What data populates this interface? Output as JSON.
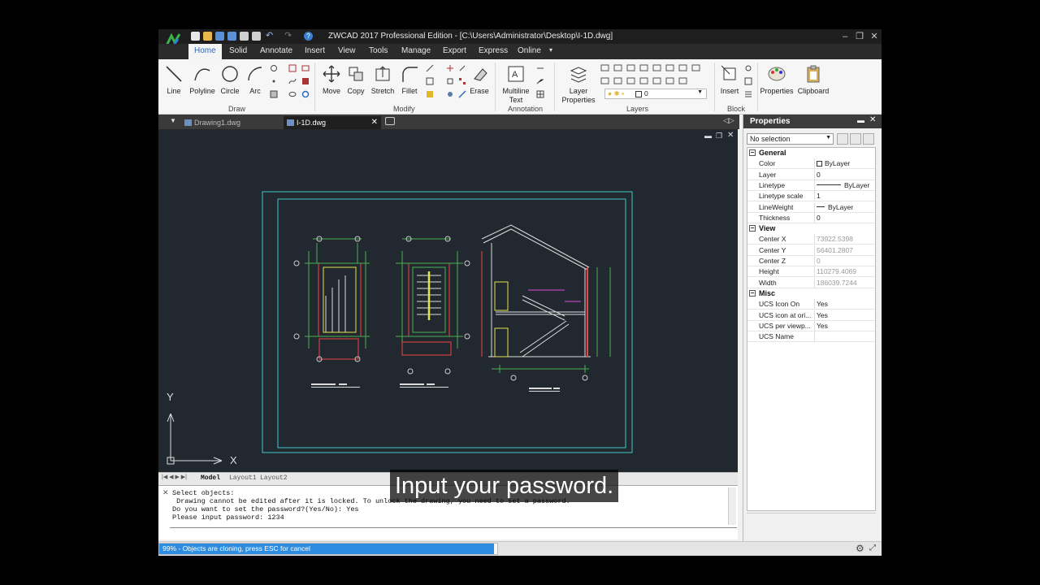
{
  "app": {
    "title": "ZWCAD 2017 Professional Edition - [C:\\Users\\Administrator\\Desktop\\I-1D.dwg]"
  },
  "ribbon_tabs": [
    "Home",
    "Solid",
    "Annotate",
    "Insert",
    "View",
    "Tools",
    "Manage",
    "Export",
    "Express",
    "Online"
  ],
  "ribbon": {
    "draw": {
      "label": "Draw",
      "tools": [
        "Line",
        "Polyline",
        "Circle",
        "Arc"
      ]
    },
    "modify": {
      "label": "Modify",
      "tools": [
        "Move",
        "Copy",
        "Stretch",
        "Fillet",
        "Erase"
      ]
    },
    "annotation": {
      "label": "Annotation",
      "tool": "Multiline",
      "tool2": "Text"
    },
    "layers": {
      "label": "Layers",
      "tool": "Layer",
      "tool2": "Properties",
      "current_layer": "0"
    },
    "block": {
      "label": "Block",
      "tool": "Insert"
    },
    "properties_tool": "Properties",
    "clipboard_tool": "Clipboard"
  },
  "doc_tabs": [
    {
      "label": "Drawing1.dwg",
      "active": false
    },
    {
      "label": "I-1D.dwg",
      "active": true
    }
  ],
  "canvas": {
    "ucs_x": "X",
    "ucs_y": "Y"
  },
  "layout_tabs": [
    "Model",
    "Layout1",
    "Layout2"
  ],
  "command": {
    "lines": [
      "Select objects:",
      " Drawing cannot be edited after it is locked. To unlock the drawing, you need to set a password.",
      "Do you want to set the password?(Yes/No): Yes",
      "Please input password: 1234"
    ]
  },
  "status": {
    "progress_text": "99% - Objects are cloning, press ESC for cancel",
    "progress": 0.99
  },
  "properties": {
    "title": "Properties",
    "selection": "No selection",
    "groups": [
      {
        "name": "General",
        "rows": [
          {
            "key": "Color",
            "value": "ByLayer"
          },
          {
            "key": "Layer",
            "value": "0"
          },
          {
            "key": "Linetype",
            "value": "ByLayer"
          },
          {
            "key": "Linetype scale",
            "value": "1"
          },
          {
            "key": "LineWeight",
            "value": "ByLayer"
          },
          {
            "key": "Thickness",
            "value": "0"
          }
        ]
      },
      {
        "name": "View",
        "rows": [
          {
            "key": "Center X",
            "value": "73922.5398"
          },
          {
            "key": "Center Y",
            "value": "56401.2807"
          },
          {
            "key": "Center Z",
            "value": "0"
          },
          {
            "key": "Height",
            "value": "110279.4069"
          },
          {
            "key": "Width",
            "value": "186039.7244"
          }
        ]
      },
      {
        "name": "Misc",
        "rows": [
          {
            "key": "UCS Icon On",
            "value": "Yes"
          },
          {
            "key": "UCS icon at ori...",
            "value": "Yes"
          },
          {
            "key": "UCS per viewp...",
            "value": "Yes"
          },
          {
            "key": "UCS Name",
            "value": ""
          }
        ]
      }
    ]
  },
  "caption": "Input your password."
}
